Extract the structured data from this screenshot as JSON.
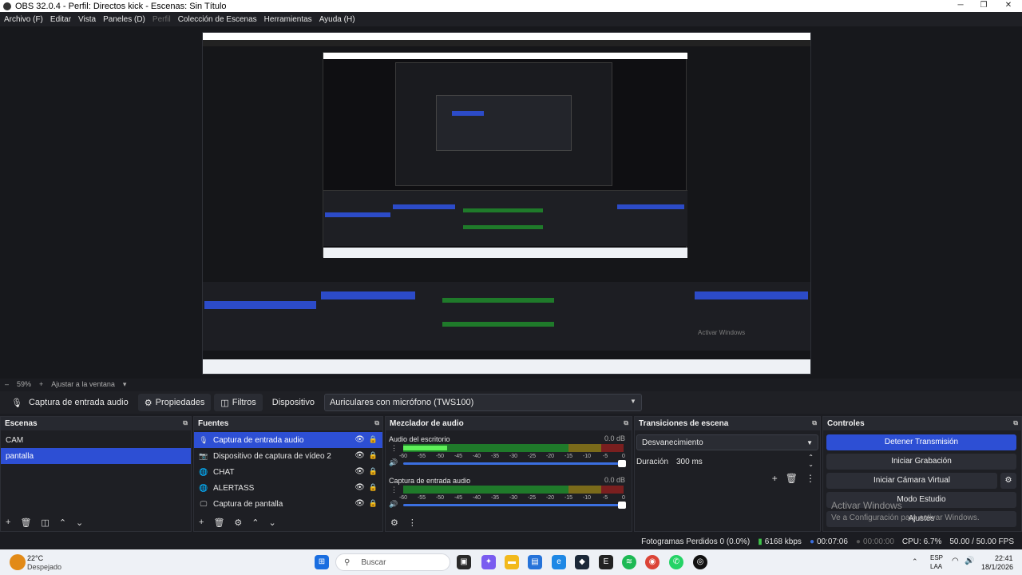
{
  "window": {
    "title": "OBS 32.0.4 - Perfil: Directos kick - Escenas: Sin Título",
    "minimize": "─",
    "maximize": "❐",
    "close": "✕"
  },
  "menu": [
    "Archivo (F)",
    "Editar",
    "Vista",
    "Paneles (D)",
    "Perfil",
    "Colección de Escenas",
    "Herramientas",
    "Ayuda (H)"
  ],
  "zoom": {
    "minus": "–",
    "value": "59%",
    "plus": "+",
    "fit": "Ajustar a la ventana"
  },
  "source_toolbar": {
    "source_name": "Captura de entrada audio",
    "properties": "Propiedades",
    "filters": "Filtros",
    "device_label": "Dispositivo",
    "device_value": "Auriculares con micrófono (TWS100)"
  },
  "scenes": {
    "title": "Escenas",
    "items": [
      {
        "label": "CAM",
        "selected": false
      },
      {
        "label": "pantalla",
        "selected": true
      }
    ]
  },
  "sources": {
    "title": "Fuentes",
    "items": [
      {
        "label": "Captura de entrada audio",
        "icon": "microphone-icon",
        "glyph": "🎙",
        "selected": true
      },
      {
        "label": "Dispositivo de captura de vídeo 2",
        "icon": "camera-icon",
        "glyph": "📷",
        "selected": false
      },
      {
        "label": "CHAT",
        "icon": "globe-icon",
        "glyph": "🌐",
        "selected": false
      },
      {
        "label": "ALERTASS",
        "icon": "globe-icon",
        "glyph": "🌐",
        "selected": false
      },
      {
        "label": "Captura de pantalla",
        "icon": "monitor-icon",
        "glyph": "🖵",
        "selected": false
      }
    ]
  },
  "mixer": {
    "title": "Mezclador de audio",
    "ticks": [
      "-60",
      "-55",
      "-50",
      "-45",
      "-40",
      "-35",
      "-30",
      "-25",
      "-20",
      "-15",
      "-10",
      "-5",
      "0"
    ],
    "channels": [
      {
        "name": "Audio del escritorio",
        "db": "0.0 dB",
        "level": 0.2
      },
      {
        "name": "Captura de entrada audio",
        "db": "0.0 dB",
        "level": 0.0
      }
    ]
  },
  "transitions": {
    "title": "Transiciones de escena",
    "type": "Desvanecimiento",
    "duration_label": "Duración",
    "duration_value": "300 ms"
  },
  "controls": {
    "title": "Controles",
    "stop_stream": "Detener Transmisión",
    "start_recording": "Iniciar Grabación",
    "start_virtual_cam": "Iniciar Cámara Virtual",
    "studio_mode": "Modo Estudio",
    "settings": "Ajustes"
  },
  "status": {
    "dropped_frames": "Fotogramas Perdidos 0 (0.0%)",
    "bitrate": "6168 kbps",
    "stream_time": "00:07:06",
    "rec_time": "00:00:00",
    "cpu": "CPU: 6.7%",
    "fps": "50.00 / 50.00 FPS"
  },
  "watermark": {
    "line1": "Activar Windows",
    "line2": "Ve a Configuración para activar Windows."
  },
  "taskbar": {
    "weather_temp": "22°C",
    "weather_desc": "Despejado",
    "search": "Buscar",
    "lang1": "ESP",
    "lang2": "LAA",
    "time": "22:41",
    "date": "18/1/2026"
  },
  "colors": {
    "accent": "#2d4fd4",
    "meter_green": "#1f7a2a",
    "meter_yellow": "#7a6a1a",
    "meter_red": "#7a1f1f",
    "level": "#5ef058"
  }
}
